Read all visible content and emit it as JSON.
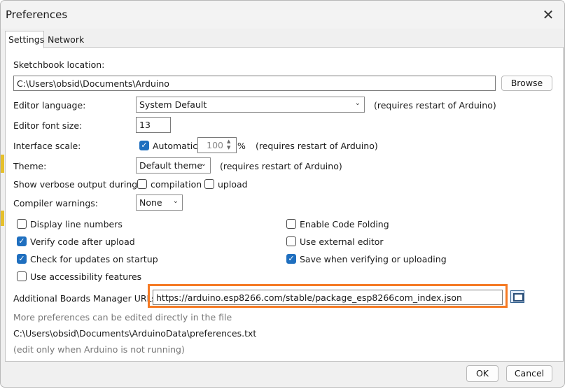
{
  "window": {
    "title": "Preferences"
  },
  "tabs": [
    {
      "label": "Settings"
    },
    {
      "label": "Network"
    }
  ],
  "settings": {
    "sketchbook_label": "Sketchbook location:",
    "sketchbook_path": "C:\\Users\\obsid\\Documents\\Arduino",
    "browse_label": "Browse",
    "editor_language_label": "Editor language:",
    "editor_language_value": "System Default",
    "restart_note": "(requires restart of Arduino)",
    "font_size_label": "Editor font size:",
    "font_size_value": "13",
    "interface_scale_label": "Interface scale:",
    "automatic_label": "Automatic",
    "scale_value": "100",
    "percent": "%",
    "theme_label": "Theme:",
    "theme_value": "Default theme",
    "verbose_label": "Show verbose output during:",
    "compilation_label": "compilation",
    "upload_label": "upload",
    "compiler_warnings_label": "Compiler warnings:",
    "compiler_warnings_value": "None",
    "checkboxes": [
      {
        "label": "Display line numbers",
        "checked": false
      },
      {
        "label": "Enable Code Folding",
        "checked": false
      },
      {
        "label": "Verify code after upload",
        "checked": true
      },
      {
        "label": "Use external editor",
        "checked": false
      },
      {
        "label": "Check for updates on startup",
        "checked": true
      },
      {
        "label": "Save when verifying or uploading",
        "checked": true
      },
      {
        "label": "Use accessibility features",
        "checked": false
      }
    ],
    "boards_urls_label": "Additional Boards Manager URLs:",
    "boards_urls_value": "https://arduino.esp8266.com/stable/package_esp8266com_index.json",
    "more_prefs_note": "More preferences can be edited directly in the file",
    "prefs_path": "C:\\Users\\obsid\\Documents\\ArduinoData\\preferences.txt",
    "edit_note": "(edit only when Arduino is not running)"
  },
  "footer": {
    "ok_label": "OK",
    "cancel_label": "Cancel"
  },
  "colors": {
    "highlight": "#f57a24",
    "checkbox_checked": "#1f6fbf"
  },
  "icons": {
    "close": "close-icon",
    "url-editor": "window-icon",
    "dropdown": "chevron-down-icon",
    "spinner": "spinner-arrows-icon"
  }
}
